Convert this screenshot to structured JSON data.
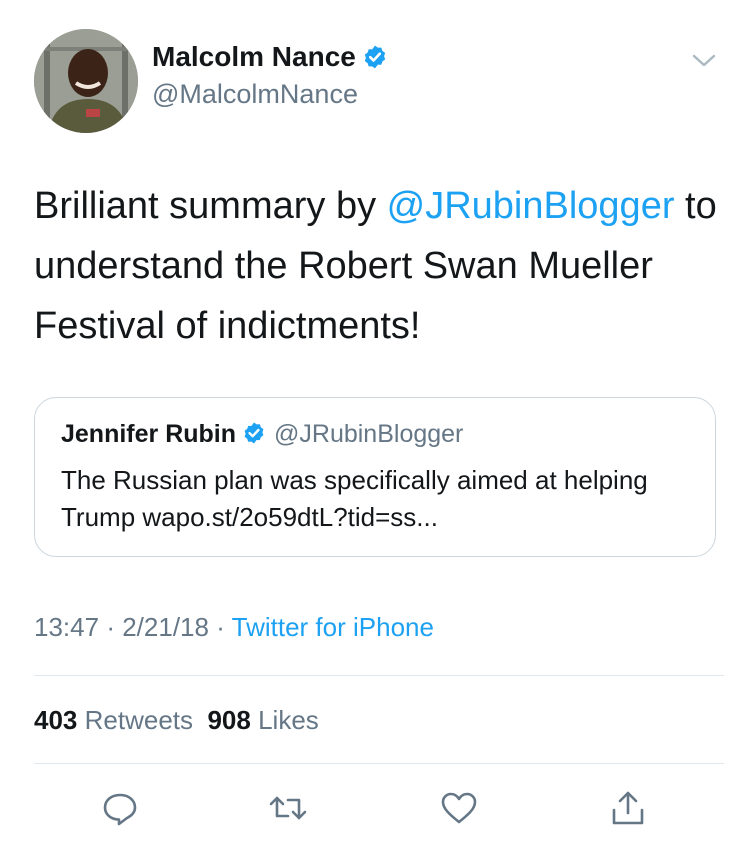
{
  "author": {
    "display_name": "Malcolm Nance",
    "handle": "@MalcolmNance",
    "verified": true
  },
  "tweet": {
    "text_part1": "Brilliant summary by ",
    "mention": "@JRubinBlogger",
    "text_part2": " to understand the Robert Swan Mueller Festival of indictments!"
  },
  "quoted_tweet": {
    "display_name": "Jennifer Rubin",
    "handle": "@JRubinBlogger",
    "verified": true,
    "text": "The Russian plan was specifically aimed at helping Trump wapo.st/2o59dtL?tid=ss..."
  },
  "meta": {
    "time": "13:47",
    "date": "2/21/18",
    "separator": "·",
    "source": "Twitter for iPhone"
  },
  "stats": {
    "retweets_count": "403",
    "retweets_label": "Retweets",
    "likes_count": "908",
    "likes_label": "Likes"
  },
  "colors": {
    "accent": "#1da1f2",
    "secondary_text": "#657786",
    "divider": "#e1e8ed"
  },
  "icons": {
    "reply": "reply-icon",
    "retweet": "retweet-icon",
    "like": "heart-icon",
    "share": "share-icon",
    "more": "chevron-down-icon",
    "verified": "verified-badge-icon"
  }
}
